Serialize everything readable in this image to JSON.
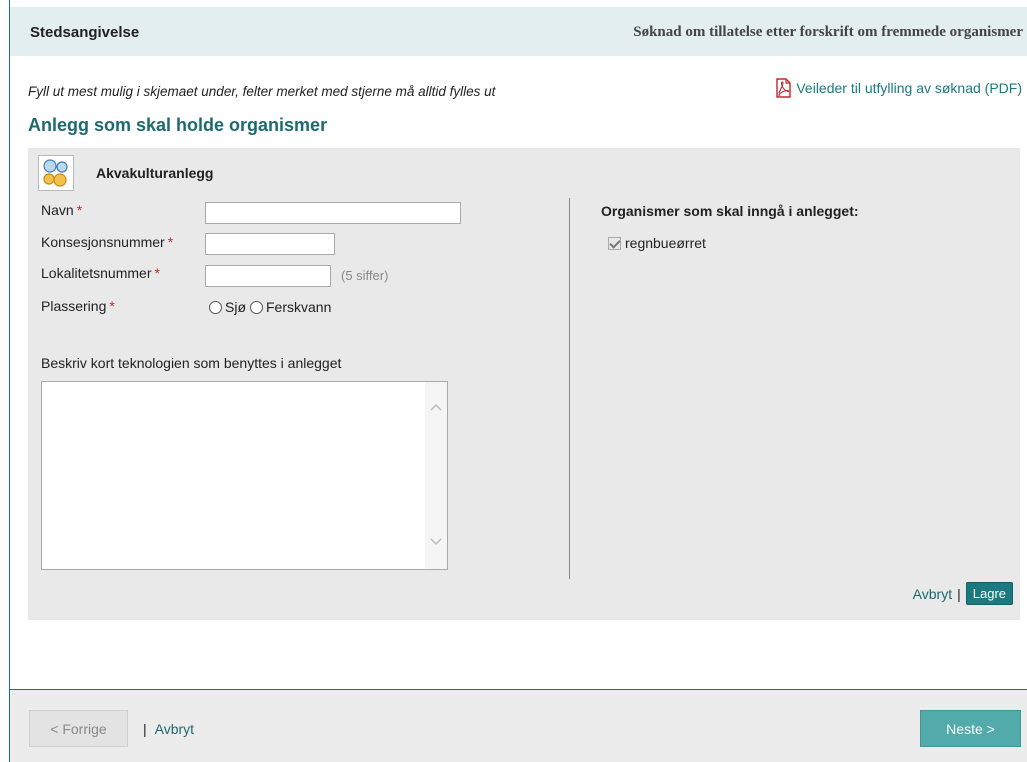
{
  "header": {
    "title": "Stedsangivelse",
    "application_title": "Søknad om tillatelse etter forskrift om fremmede organismer"
  },
  "instructions": "Fyll ut mest mulig i skjemaet under, felter merket med stjerne må alltid fylles ut",
  "guide_link": {
    "label": "Veileder til utfylling av søknad (PDF)",
    "icon": "pdf-icon"
  },
  "section_title": "Anlegg som skal holde organismer",
  "panel": {
    "icon": "aquaculture-icon",
    "title": "Akvakulturanlegg",
    "fields": {
      "navn": {
        "label": "Navn",
        "required_mark": "*",
        "value": ""
      },
      "konsesjonsnummer": {
        "label": "Konsesjonsnummer",
        "required_mark": "*",
        "value": ""
      },
      "lokalitetsnummer": {
        "label": "Lokalitetsnummer",
        "required_mark": "*",
        "value": "",
        "hint": "(5 siffer)"
      },
      "plassering": {
        "label": "Plassering",
        "required_mark": "*",
        "options": [
          "Sjø",
          "Ferskvann"
        ],
        "selected": null
      }
    },
    "technology": {
      "label": "Beskriv kort teknologien som benyttes i anlegget",
      "value": ""
    },
    "organisms": {
      "title": "Organismer som skal inngå i anlegget:",
      "items": [
        {
          "label": "regnbueørret",
          "checked": true,
          "disabled": true
        }
      ]
    },
    "actions": {
      "cancel_label": "Avbryt",
      "separator": "|",
      "save_label": "Lagre"
    }
  },
  "footer": {
    "prev_label": "< Forrige",
    "separator": "|",
    "cancel_label": "Avbryt",
    "next_label": "Neste >"
  },
  "colors": {
    "accent": "#1c6a70",
    "header_bg": "#e3eef0",
    "panel_bg": "#e9e9e9",
    "required": "#c0282e",
    "next_button": "#52aaaa"
  }
}
